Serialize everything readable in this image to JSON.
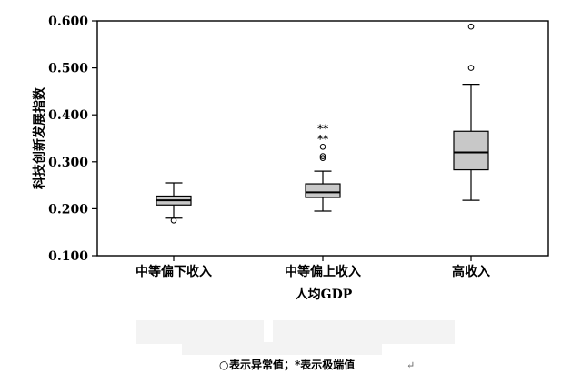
{
  "chart_data": {
    "type": "boxplot",
    "ylabel": "科技创新发展指数",
    "xlabel": "人均GDP",
    "ylim": [
      0.1,
      0.6
    ],
    "yticks": [
      "0.100",
      "0.200",
      "0.300",
      "0.400",
      "0.500",
      "0.600"
    ],
    "categories": [
      "中等偏下收入",
      "中等偏上收入",
      "高收入"
    ],
    "boxes": [
      {
        "category": "中等偏下收入",
        "whisker_low": 0.18,
        "q1": 0.208,
        "median": 0.218,
        "q3": 0.227,
        "whisker_high": 0.255,
        "outliers": [
          0.175
        ],
        "extremes": []
      },
      {
        "category": "中等偏上收入",
        "whisker_low": 0.195,
        "q1": 0.224,
        "median": 0.235,
        "q3": 0.253,
        "whisker_high": 0.28,
        "outliers": [
          0.308,
          0.312,
          0.332
        ],
        "extremes": [
          0.35,
          0.372
        ]
      },
      {
        "category": "高收入",
        "whisker_low": 0.218,
        "q1": 0.283,
        "median": 0.32,
        "q3": 0.365,
        "whisker_high": 0.465,
        "outliers": [
          0.5,
          0.588
        ],
        "extremes": []
      }
    ],
    "colors": {
      "box_fill": "#c8c8c8",
      "line": "#000000",
      "background": "#ffffff"
    },
    "grid": false,
    "note": "表示异常值；*表示极端值",
    "note_circle": "○",
    "note_marker": "↵"
  }
}
